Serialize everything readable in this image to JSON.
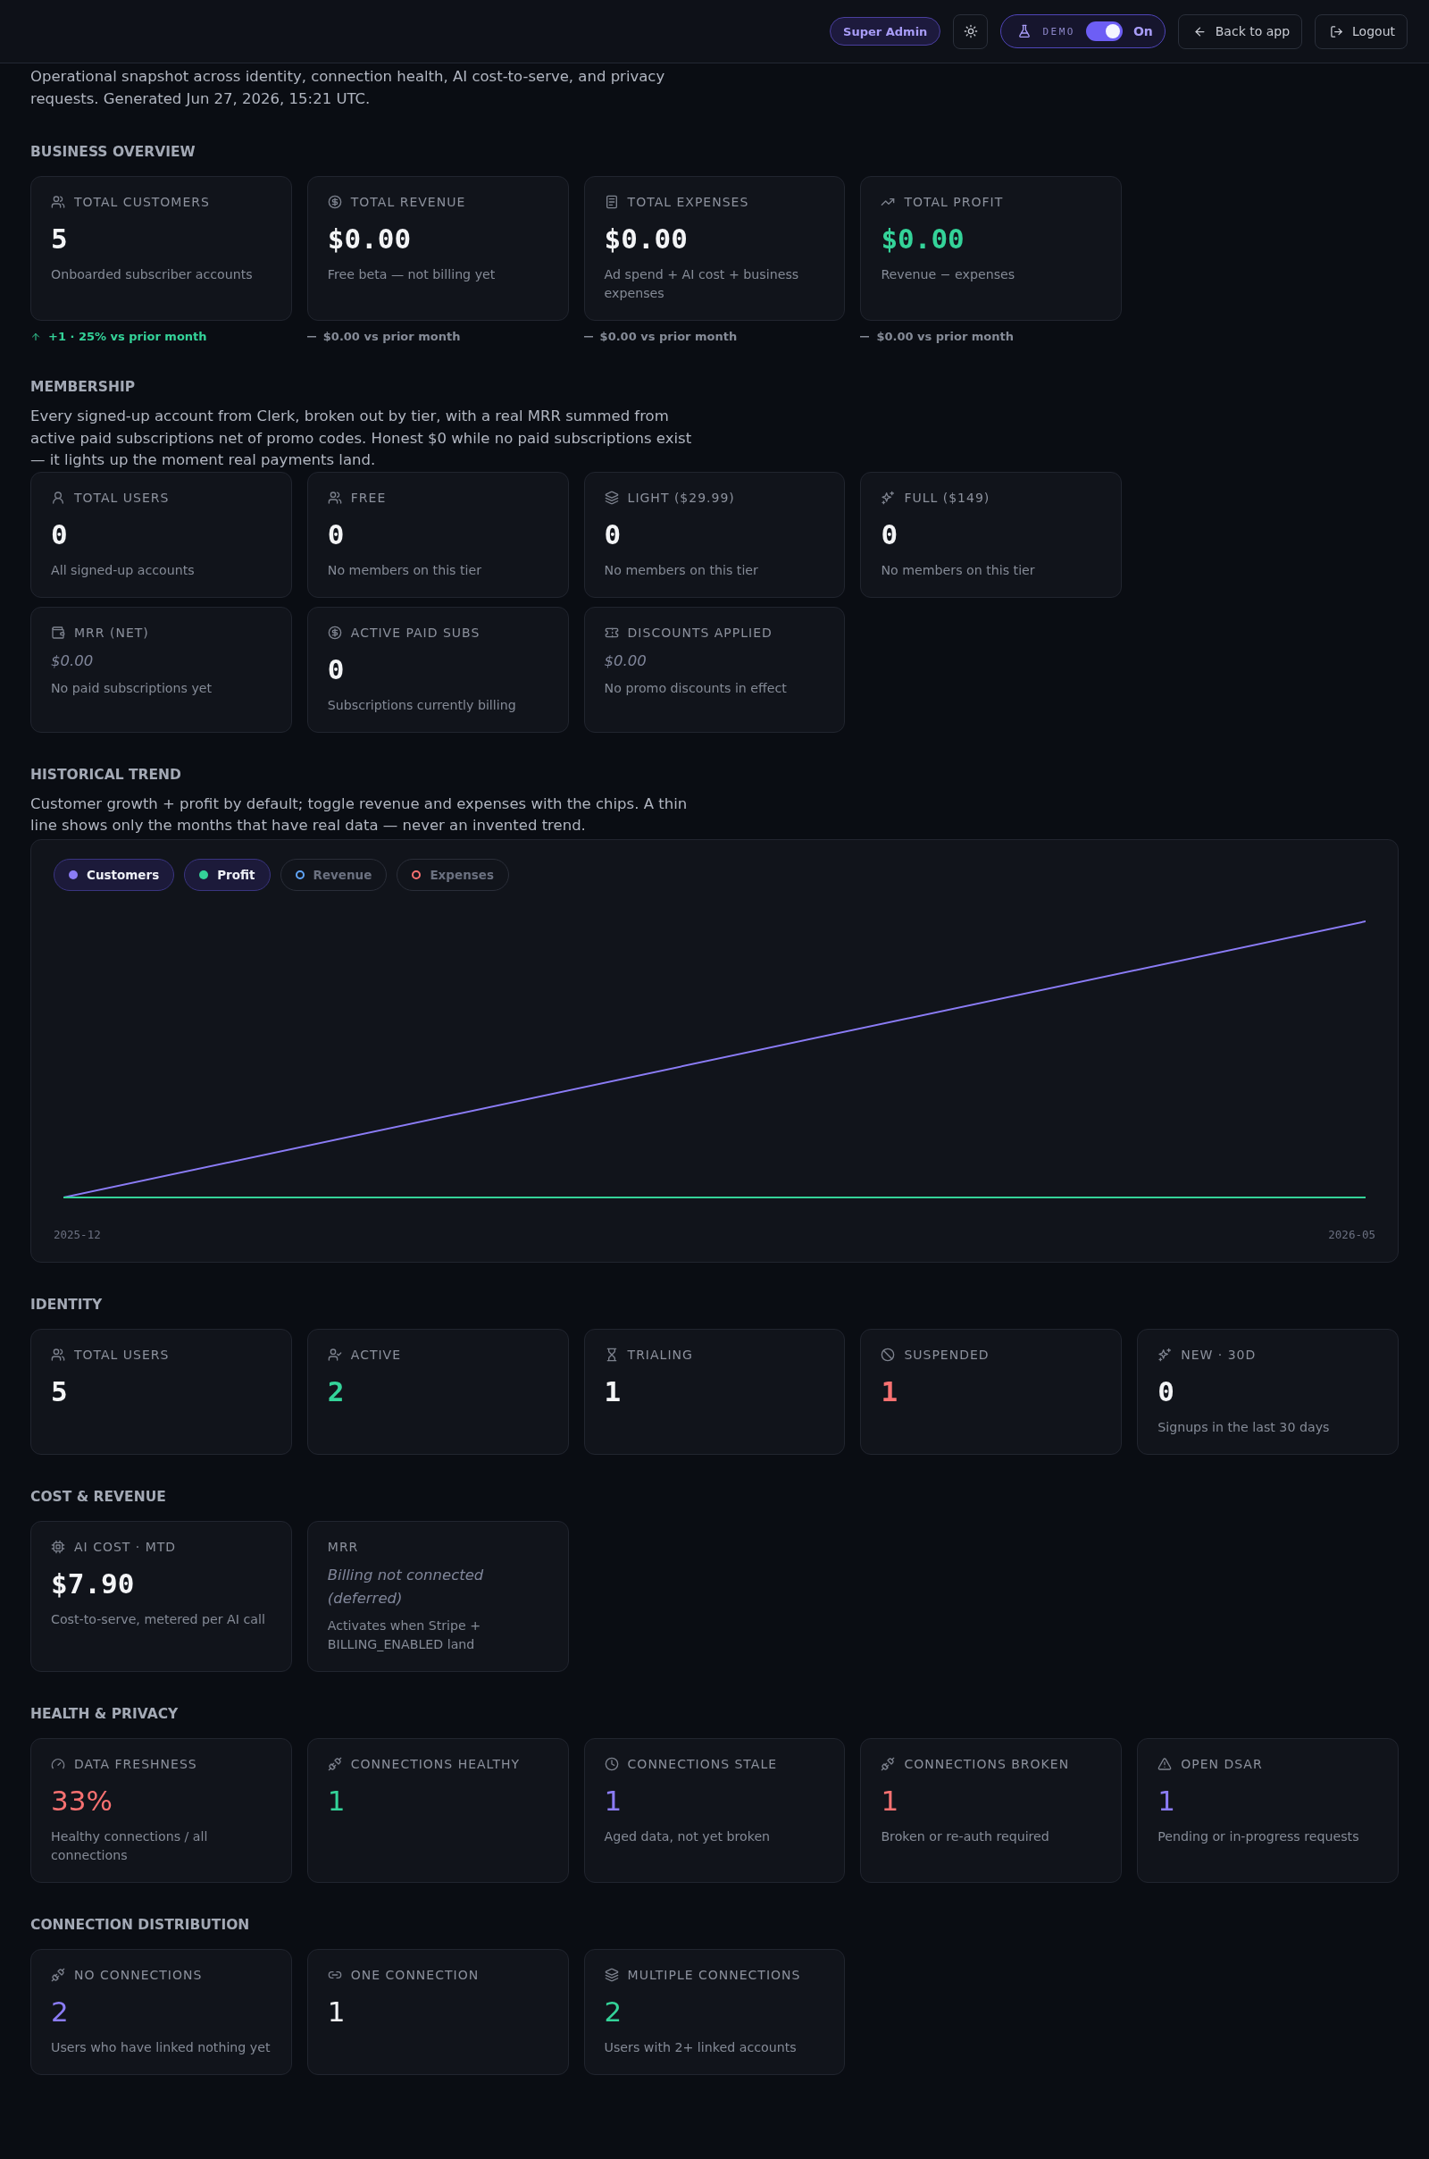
{
  "top_bar": {
    "role_badge": "Super Admin",
    "demo": {
      "label": "DEMO",
      "on": true,
      "state_label": "On"
    },
    "buttons": [
      {
        "kind": "back",
        "label": "Back to app"
      },
      {
        "kind": "logout",
        "label": "Logout"
      }
    ]
  },
  "intro": "Operational snapshot across identity, connection health, AI cost-to-serve, and privacy requests. Generated Jun 27, 2026, 15:21 UTC.",
  "sections": [
    {
      "kind": "cards",
      "title": "BUSINESS OVERVIEW",
      "card_rows": [
        [
          {
            "kind": "count",
            "label": "TOTAL CUSTOMERS",
            "value": "5",
            "color": "#f3f4f6",
            "note": "Onboarded subscriber accounts",
            "delta": {
              "kind": "up",
              "text": "+1 · 25% vs prior month"
            }
          },
          {
            "kind": "count",
            "label": "TOTAL REVENUE",
            "value": "$0.00",
            "color": "#f3f4f6",
            "note": "Free beta — not billing yet",
            "delta": {
              "kind": "flat",
              "text": "$0.00 vs prior month"
            }
          },
          {
            "kind": "count",
            "label": "TOTAL EXPENSES",
            "value": "$0.00",
            "color": "#f3f4f6",
            "note": "Ad spend + AI cost + business expenses",
            "delta": {
              "kind": "flat",
              "text": "$0.00 vs prior month"
            }
          },
          {
            "kind": "count",
            "label": "TOTAL PROFIT",
            "value": "$0.00",
            "color": "#34d399",
            "note": "Revenue − expenses",
            "delta": {
              "kind": "flat",
              "text": "$0.00 vs prior month"
            }
          }
        ]
      ]
    },
    {
      "kind": "cards",
      "title": "MEMBERSHIP",
      "description": "Every signed-up account from Clerk, broken out by tier, with a real MRR summed from active paid subscriptions net of promo codes. Honest $0 while no paid subscriptions exist — it lights up the moment real payments land.",
      "card_rows": [
        [
          {
            "kind": "count",
            "label": "TOTAL USERS",
            "value": "0",
            "color": "#f3f4f6",
            "note": "All signed-up accounts"
          },
          {
            "kind": "count",
            "label": "FREE",
            "value": "0",
            "color": "#f3f4f6",
            "note": "No members on this tier"
          },
          {
            "kind": "count",
            "label": "LIGHT ($29.99)",
            "value": "0",
            "color": "#f3f4f6",
            "note": "No members on this tier"
          },
          {
            "kind": "count",
            "label": "FULL ($149)",
            "value": "0",
            "color": "#f3f4f6",
            "note": "No members on this tier"
          }
        ],
        [
          {
            "kind": "pending",
            "label": "MRR (NET)",
            "value": "$0.00",
            "note": "No paid subscriptions yet"
          },
          {
            "kind": "count",
            "label": "ACTIVE PAID SUBS",
            "value": "0",
            "color": "#f3f4f6",
            "note": "Subscriptions currently billing"
          },
          {
            "kind": "pending",
            "label": "DISCOUNTS APPLIED",
            "value": "$0.00",
            "note": "No promo discounts in effect"
          }
        ]
      ]
    },
    {
      "kind": "chart",
      "title": "HISTORICAL TREND",
      "description": "Customer growth + profit by default; toggle revenue and expenses with the chips. A thin line shows only the months that have real data — never an invented trend.",
      "chips": [
        {
          "label": "Customers",
          "color": "#8b7cf6",
          "selected": true
        },
        {
          "label": "Profit",
          "color": "#34d399",
          "selected": true
        },
        {
          "label": "Revenue",
          "color": "#60a5fa",
          "selected": false
        },
        {
          "label": "Expenses",
          "color": "#f87171",
          "selected": false
        }
      ],
      "x_labels": [
        "2025-12",
        "2026-05"
      ]
    },
    {
      "kind": "cards",
      "title": "IDENTITY",
      "card_rows": [
        [
          {
            "kind": "count",
            "label": "TOTAL USERS",
            "value": "5",
            "color": "#f3f4f6"
          },
          {
            "kind": "count",
            "label": "ACTIVE",
            "value": "2",
            "color": "#34d399"
          },
          {
            "kind": "count",
            "label": "TRIALING",
            "value": "1",
            "color": "#f3f4f6"
          },
          {
            "kind": "count",
            "label": "SUSPENDED",
            "value": "1",
            "color": "#f87171"
          },
          {
            "kind": "count",
            "label": "NEW · 30D",
            "value": "0",
            "color": "#f3f4f6",
            "note": "Signups in the last 30 days"
          }
        ]
      ]
    },
    {
      "kind": "cards",
      "title": "COST & REVENUE",
      "card_rows": [
        [
          {
            "kind": "count",
            "label": "AI COST · MTD",
            "value": "$7.90",
            "color": "#f3f4f6",
            "note": "Cost-to-serve, metered per AI call"
          },
          {
            "kind": "pending",
            "label": "MRR",
            "value": "Billing not connected (deferred)",
            "note": "Activates when Stripe + BILLING_ENABLED land"
          }
        ]
      ]
    },
    {
      "kind": "cards",
      "title": "HEALTH & PRIVACY",
      "card_rows": [
        [
          {
            "kind": "signal",
            "label": "DATA FRESHNESS",
            "value": "33%",
            "color": "#f87171",
            "note": "Healthy connections / all connections"
          },
          {
            "kind": "signal",
            "label": "CONNECTIONS HEALTHY",
            "value": "1",
            "color": "#34d399"
          },
          {
            "kind": "signal",
            "label": "CONNECTIONS STALE",
            "value": "1",
            "color": "#8b7cf6",
            "note": "Aged data, not yet broken"
          },
          {
            "kind": "signal",
            "label": "CONNECTIONS BROKEN",
            "value": "1",
            "color": "#f87171",
            "note": "Broken or re-auth required"
          },
          {
            "kind": "signal",
            "label": "OPEN DSAR",
            "value": "1",
            "color": "#8b7cf6",
            "note": "Pending or in-progress requests"
          }
        ]
      ]
    },
    {
      "kind": "cards",
      "title": "CONNECTION DISTRIBUTION",
      "card_rows": [
        [
          {
            "kind": "signal",
            "label": "NO CONNECTIONS",
            "value": "2",
            "color": "#8b7cf6",
            "note": "Users who have linked nothing yet"
          },
          {
            "kind": "signal",
            "label": "ONE CONNECTION",
            "value": "1",
            "color": "#f3f4f6"
          },
          {
            "kind": "signal",
            "label": "MULTIPLE CONNECTIONS",
            "value": "2",
            "color": "#34d399",
            "note": "Users with 2+ linked accounts"
          }
        ]
      ]
    }
  ]
}
